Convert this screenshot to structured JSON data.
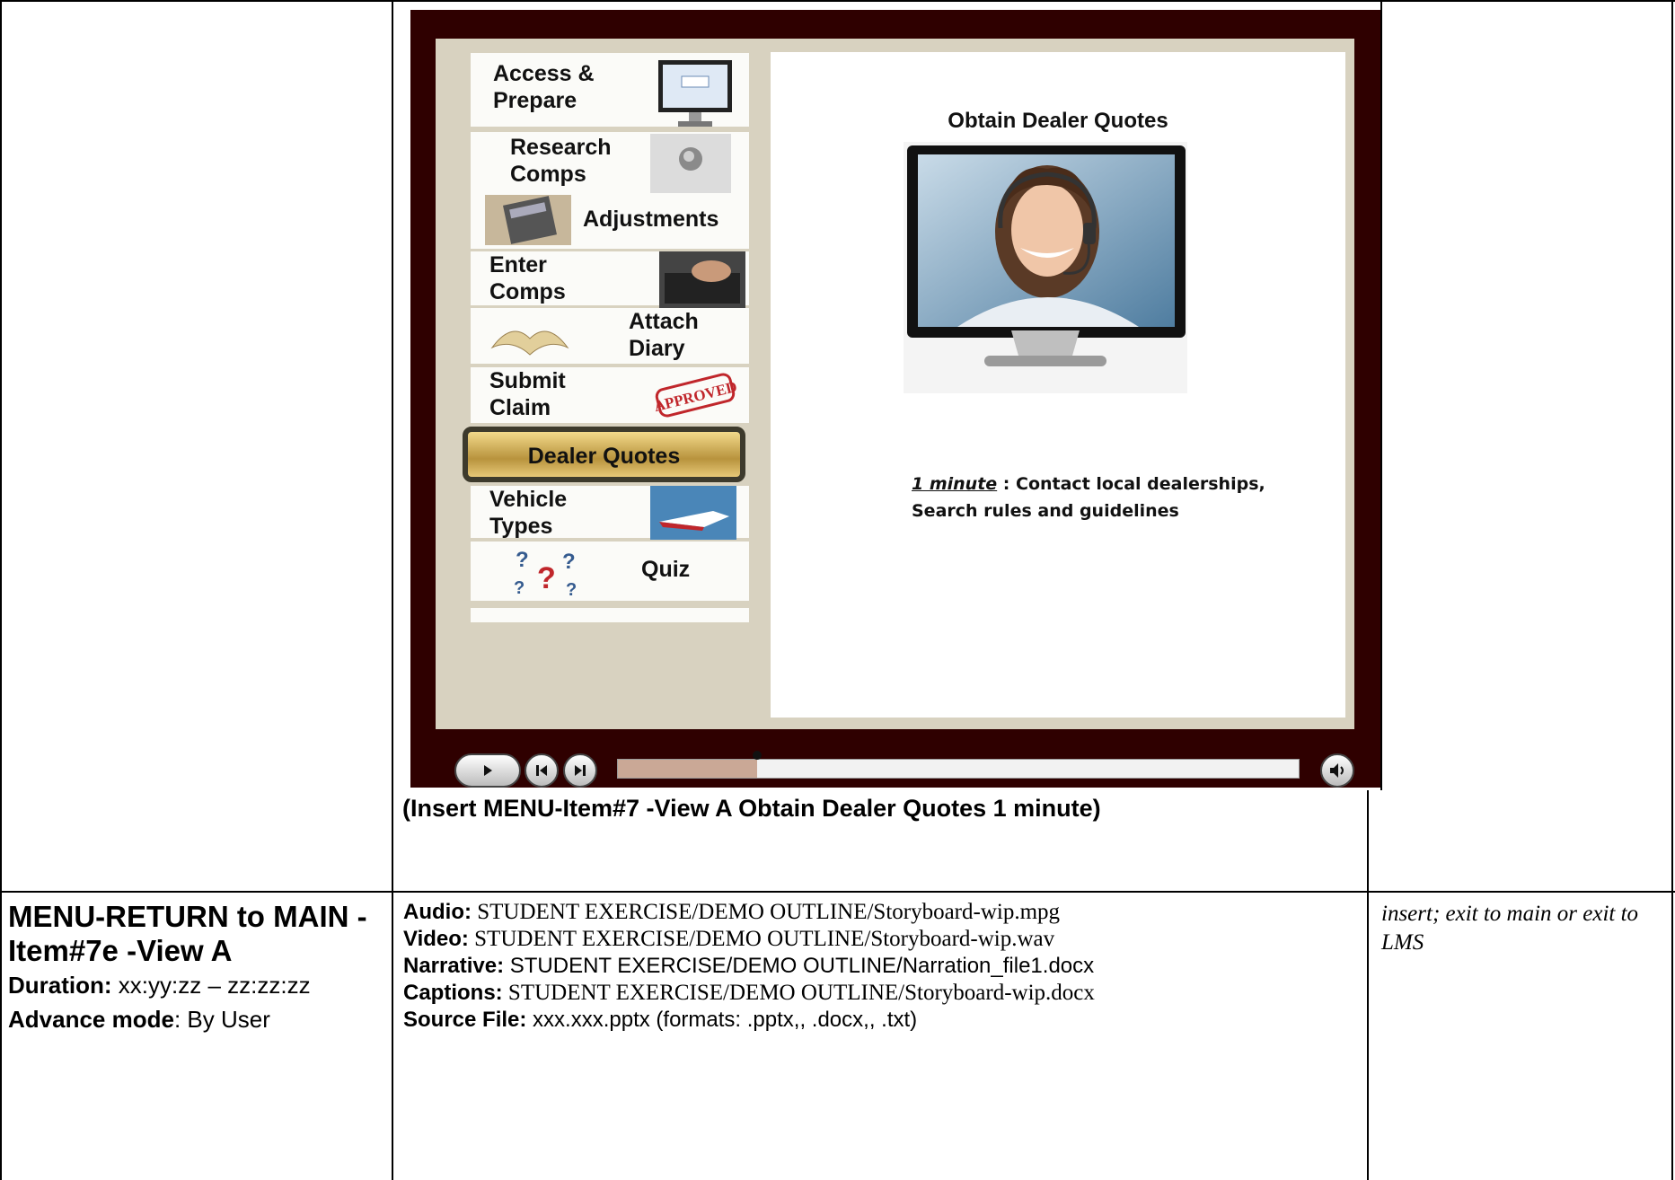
{
  "slide": {
    "menu": [
      {
        "label": "Access &\nPrepare",
        "icon": "monitor-icon"
      },
      {
        "label": "Research\nComps",
        "icon": "search-button-icon"
      },
      {
        "label": "Adjustments",
        "icon": "calculator-icon"
      },
      {
        "label": "Enter\nComps",
        "icon": "keyboard-icon"
      },
      {
        "label": "Attach\nDiary",
        "icon": "open-book-icon"
      },
      {
        "label": "Submit\nClaim",
        "icon": "approved-stamp-icon",
        "stamp_text": "APPROVED"
      },
      {
        "label": "Dealer Quotes",
        "icon": "",
        "selected": true
      },
      {
        "label": "Vehicle\nTypes",
        "icon": "speedboat-icon"
      },
      {
        "label": "Quiz",
        "icon": "question-marks-icon"
      }
    ],
    "content": {
      "title": "Obtain Dealer Quotes",
      "image": "headset-agent-on-monitor-image",
      "duration": "1 minute",
      "description_line1": " : Contact local dealerships,",
      "description_line2": "Search rules and guidelines"
    },
    "player": {
      "progress": 0.205,
      "buttons": [
        "play-icon",
        "previous-icon",
        "next-icon",
        "volume-icon"
      ]
    },
    "colors": {
      "frame": "#2f0000",
      "panel": "#d8d2c0",
      "selected": "#c9a84f"
    }
  },
  "caption": "(Insert MENU-Item#7 -View A Obtain Dealer Quotes 1 minute)",
  "row": {
    "title": "MENU-RETURN to MAIN - Item#7e -View A",
    "duration_label": "Duration:",
    "duration_value": " xx:yy:zz – zz:zz:zz",
    "advance_label": "Advance mode",
    "advance_value": ": By User",
    "files": [
      {
        "label": "Audio:",
        "value": " STUDENT EXERCISE/DEMO OUTLINE/Storyboard-wip.mpg",
        "serif": true
      },
      {
        "label": "Video:",
        "value": " STUDENT EXERCISE/DEMO OUTLINE/Storyboard-wip.wav",
        "serif": true
      },
      {
        "label": "Narrative:",
        "value": " STUDENT EXERCISE/DEMO OUTLINE/Narration_file1.docx",
        "serif": false
      },
      {
        "label": "Captions:",
        "value": " STUDENT EXERCISE/DEMO OUTLINE/Storyboard-wip.docx",
        "serif": true
      },
      {
        "label": "Source File:",
        "value": " xxx.xxx.pptx  (formats: .pptx,, .docx,, .txt)",
        "serif": false
      }
    ],
    "notes": "insert; exit to main or exit to LMS"
  }
}
